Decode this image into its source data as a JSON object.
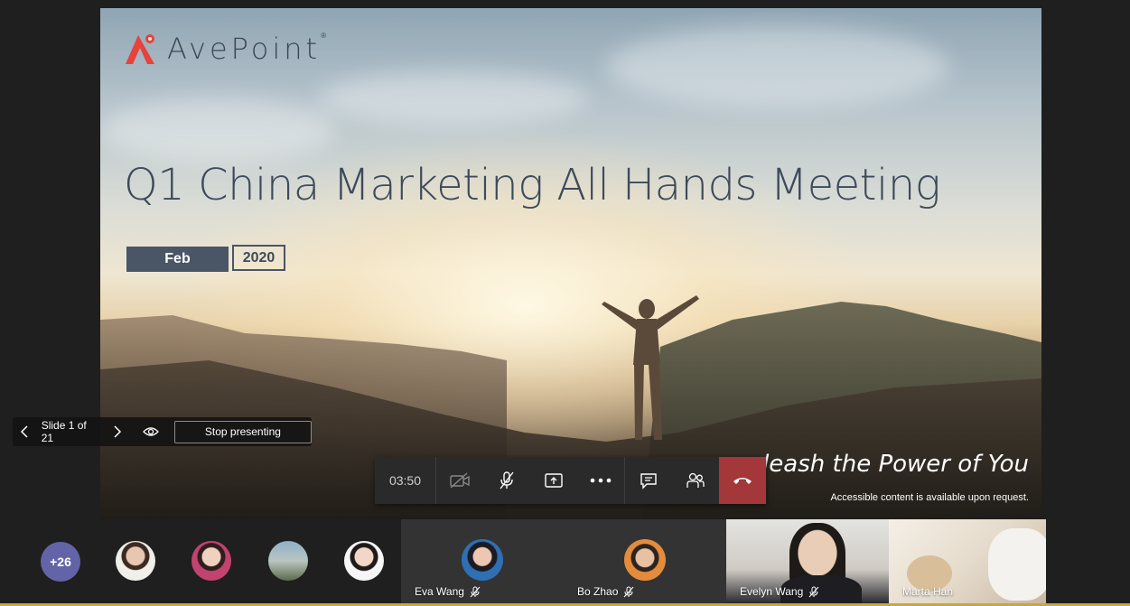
{
  "slide": {
    "logo_text": "AvePoint",
    "logo_reg": "®",
    "title": "Q1 China Marketing All Hands Meeting",
    "month": "Feb",
    "year": "2020",
    "tagline": "leash the Power of You",
    "accessible_note": "Accessible content is available upon request."
  },
  "presenter_bar": {
    "slide_counter": "Slide 1 of 21",
    "stop_label": "Stop presenting"
  },
  "call_controls": {
    "timer": "03:50",
    "buttons": [
      "camera-off-icon",
      "mic-off-icon",
      "share-screen-icon",
      "more-options-icon",
      "chat-icon",
      "participants-icon",
      "hang-up-icon"
    ],
    "hangup_color": "#a4373a"
  },
  "participants": {
    "overflow_count": "+26",
    "overflow_color": "#6264a7",
    "tiles": [
      {
        "name": "Eva Wang"
      },
      {
        "name": "Bo Zhao"
      },
      {
        "name": "Evelyn Wang"
      },
      {
        "name": "Marta Han"
      }
    ]
  },
  "colors": {
    "logo_red": "#e8423c",
    "slide_text": "#3e4a5a",
    "teams_purple": "#6264a7"
  }
}
